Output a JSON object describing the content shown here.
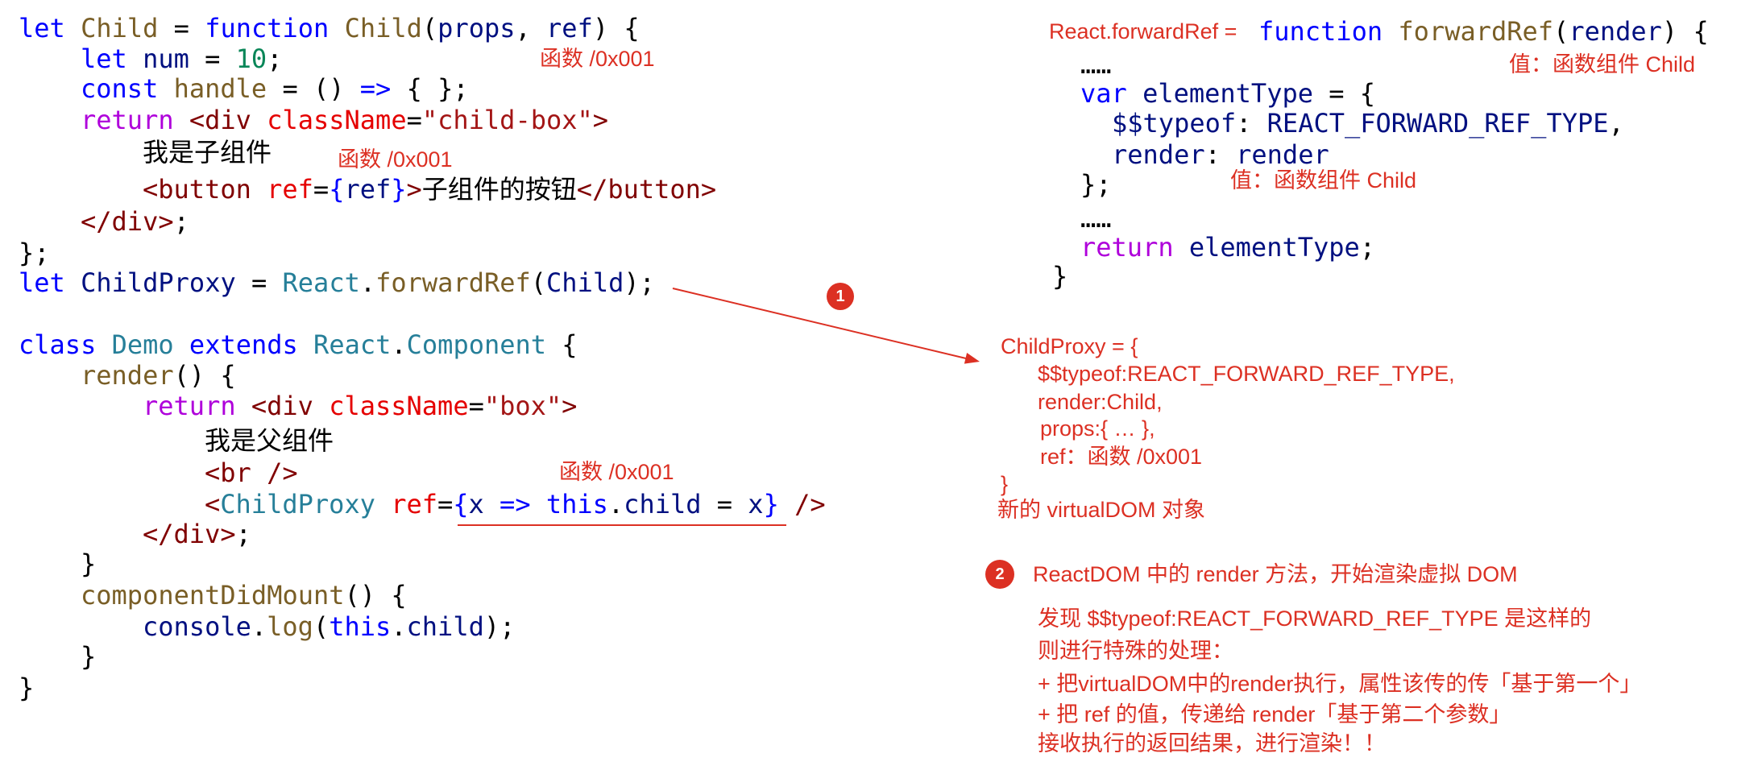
{
  "colors": {
    "annotation": "#dc3023",
    "text": "#000000"
  },
  "left_code": {
    "lines": [
      [
        {
          "t": "let",
          "c": "#0000ff"
        },
        {
          "t": " Child",
          "c": "#795e26"
        },
        {
          "t": " = ",
          "c": "#000000"
        },
        {
          "t": "function",
          "c": "#0000ff"
        },
        {
          "t": " Child",
          "c": "#795e26"
        },
        {
          "t": "(",
          "c": "#000000"
        },
        {
          "t": "props",
          "c": "#001080"
        },
        {
          "t": ", ",
          "c": "#000000"
        },
        {
          "t": "ref",
          "c": "#001080"
        },
        {
          "t": ") {",
          "c": "#000000"
        }
      ],
      [
        {
          "t": "let",
          "c": "#0000ff"
        },
        {
          "t": " num",
          "c": "#001080"
        },
        {
          "t": " = ",
          "c": "#000000"
        },
        {
          "t": "10",
          "c": "#098658"
        },
        {
          "t": ";",
          "c": "#000000"
        }
      ],
      [
        {
          "t": "const",
          "c": "#0000ff"
        },
        {
          "t": " handle",
          "c": "#795e26"
        },
        {
          "t": " = () ",
          "c": "#000000"
        },
        {
          "t": "=>",
          "c": "#0000ff"
        },
        {
          "t": " { };",
          "c": "#000000"
        }
      ],
      [
        {
          "t": "return",
          "c": "#af00db"
        },
        {
          "t": " <div",
          "c": "#800000"
        },
        {
          "t": " className",
          "c": "#e50000"
        },
        {
          "t": "=",
          "c": "#000000"
        },
        {
          "t": "\"child-box\"",
          "c": "#a31515"
        },
        {
          "t": ">",
          "c": "#800000"
        }
      ],
      [
        {
          "t": "我是子组件",
          "c": "#000000"
        }
      ],
      [
        {
          "t": "<button",
          "c": "#800000"
        },
        {
          "t": " ref",
          "c": "#e50000"
        },
        {
          "t": "=",
          "c": "#000000"
        },
        {
          "t": "{",
          "c": "#0000ff"
        },
        {
          "t": "ref",
          "c": "#001080"
        },
        {
          "t": "}",
          "c": "#0000ff"
        },
        {
          "t": ">",
          "c": "#800000"
        },
        {
          "t": "子组件的按钮",
          "c": "#000000"
        },
        {
          "t": "</button>",
          "c": "#800000"
        }
      ],
      [
        {
          "t": "</div>",
          "c": "#800000"
        },
        {
          "t": ";",
          "c": "#000000"
        }
      ],
      [
        {
          "t": "};",
          "c": "#000000"
        }
      ],
      [
        {
          "t": "let",
          "c": "#0000ff"
        },
        {
          "t": " ChildProxy",
          "c": "#001080"
        },
        {
          "t": " = ",
          "c": "#000000"
        },
        {
          "t": "React",
          "c": "#267f99"
        },
        {
          "t": ".",
          "c": "#000000"
        },
        {
          "t": "forwardRef",
          "c": "#795e26"
        },
        {
          "t": "(",
          "c": "#000000"
        },
        {
          "t": "Child",
          "c": "#001080"
        },
        {
          "t": ");",
          "c": "#000000"
        }
      ],
      [
        {
          "t": "class",
          "c": "#0000ff"
        },
        {
          "t": " Demo",
          "c": "#267f99"
        },
        {
          "t": " extends",
          "c": "#0000ff"
        },
        {
          "t": " React",
          "c": "#267f99"
        },
        {
          "t": ".",
          "c": "#000000"
        },
        {
          "t": "Component",
          "c": "#267f99"
        },
        {
          "t": " {",
          "c": "#000000"
        }
      ],
      [
        {
          "t": "render",
          "c": "#795e26"
        },
        {
          "t": "() {",
          "c": "#000000"
        }
      ],
      [
        {
          "t": "return",
          "c": "#af00db"
        },
        {
          "t": " <div",
          "c": "#800000"
        },
        {
          "t": " className",
          "c": "#e50000"
        },
        {
          "t": "=",
          "c": "#000000"
        },
        {
          "t": "\"box\"",
          "c": "#a31515"
        },
        {
          "t": ">",
          "c": "#800000"
        }
      ],
      [
        {
          "t": "我是父组件",
          "c": "#000000"
        }
      ],
      [
        {
          "t": "<br />",
          "c": "#800000"
        }
      ],
      [
        {
          "t": "<",
          "c": "#800000"
        },
        {
          "t": "ChildProxy",
          "c": "#267f99"
        },
        {
          "t": " ref",
          "c": "#e50000"
        },
        {
          "t": "=",
          "c": "#000000"
        },
        {
          "t": "{",
          "c": "#0000ff"
        },
        {
          "t": "x",
          "c": "#001080"
        },
        {
          "t": " =>",
          "c": "#0000ff"
        },
        {
          "t": " this",
          "c": "#0000ff"
        },
        {
          "t": ".",
          "c": "#000000"
        },
        {
          "t": "child",
          "c": "#001080"
        },
        {
          "t": " = ",
          "c": "#000000"
        },
        {
          "t": "x",
          "c": "#001080"
        },
        {
          "t": "}",
          "c": "#0000ff"
        },
        {
          "t": " />",
          "c": "#800000"
        }
      ],
      [
        {
          "t": "</div>",
          "c": "#800000"
        },
        {
          "t": ";",
          "c": "#000000"
        }
      ],
      [
        {
          "t": "}",
          "c": "#000000"
        }
      ],
      [
        {
          "t": "componentDidMount",
          "c": "#795e26"
        },
        {
          "t": "() {",
          "c": "#000000"
        }
      ],
      [
        {
          "t": "console",
          "c": "#001080"
        },
        {
          "t": ".",
          "c": "#000000"
        },
        {
          "t": "log",
          "c": "#795e26"
        },
        {
          "t": "(",
          "c": "#000000"
        },
        {
          "t": "this",
          "c": "#0000ff"
        },
        {
          "t": ".",
          "c": "#000000"
        },
        {
          "t": "child",
          "c": "#001080"
        },
        {
          "t": ");",
          "c": "#000000"
        }
      ],
      [
        {
          "t": "}",
          "c": "#000000"
        }
      ],
      [
        {
          "t": "}",
          "c": "#000000"
        }
      ]
    ]
  },
  "right_code": {
    "header_label": "React.forwardRef =",
    "lines": [
      [
        {
          "t": "function",
          "c": "#0000ff"
        },
        {
          "t": " forwardRef",
          "c": "#795e26"
        },
        {
          "t": "(",
          "c": "#000000"
        },
        {
          "t": "render",
          "c": "#001080"
        },
        {
          "t": ") {",
          "c": "#000000"
        }
      ],
      [
        {
          "t": "……",
          "c": "#000000"
        }
      ],
      [
        {
          "t": "var",
          "c": "#0000ff"
        },
        {
          "t": " elementType",
          "c": "#001080"
        },
        {
          "t": " = {",
          "c": "#000000"
        }
      ],
      [
        {
          "t": "$$typeof",
          "c": "#001080"
        },
        {
          "t": ": ",
          "c": "#000000"
        },
        {
          "t": "REACT_FORWARD_REF_TYPE",
          "c": "#001080"
        },
        {
          "t": ",",
          "c": "#000000"
        }
      ],
      [
        {
          "t": "render",
          "c": "#001080"
        },
        {
          "t": ": ",
          "c": "#000000"
        },
        {
          "t": "render",
          "c": "#001080"
        }
      ],
      [
        {
          "t": "};",
          "c": "#000000"
        }
      ],
      [
        {
          "t": "……",
          "c": "#000000"
        }
      ],
      [
        {
          "t": "return",
          "c": "#af00db"
        },
        {
          "t": " elementType",
          "c": "#001080"
        },
        {
          "t": ";",
          "c": "#000000"
        }
      ],
      [
        {
          "t": "}",
          "c": "#000000"
        }
      ]
    ]
  },
  "annotations": {
    "a1": "函数 /0x001",
    "a2": "函数 /0x001",
    "a3": "函数 /0x001",
    "a4": "值：函数组件 Child",
    "a5": "值：函数组件 Child"
  },
  "virtual_dom": {
    "lines": [
      "ChildProxy = {",
      "$$typeof:REACT_FORWARD_REF_TYPE,",
      "render:Child,",
      "props:{ … },",
      "ref：函数 /0x001",
      "}"
    ],
    "caption": "新的 virtualDOM 对象"
  },
  "steps": [
    {
      "number": "1"
    },
    {
      "number": "2",
      "title": "ReactDOM 中的 render 方法，开始渲染虚拟 DOM",
      "details": [
        "发现 $$typeof:REACT_FORWARD_REF_TYPE 是这样的",
        "则进行特殊的处理：",
        "+ 把virtualDOM中的render执行，属性该传的传「基于第一个」",
        "+ 把 ref 的值，传递给 render「基于第二个参数」",
        "接收执行的返回结果，进行渲染！！"
      ]
    }
  ]
}
